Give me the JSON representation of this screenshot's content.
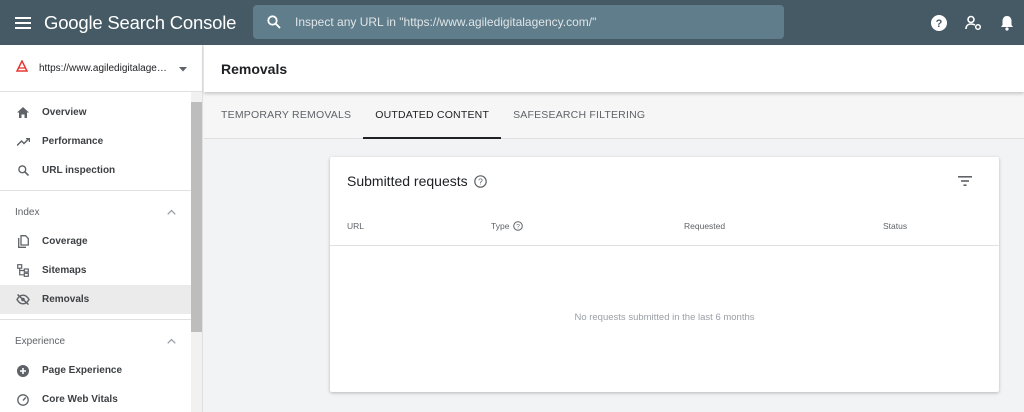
{
  "header": {
    "brand": "Google Search Console",
    "search_placeholder": "Inspect any URL in \"https://www.agiledigitalagency.com/\""
  },
  "sidebar": {
    "property_label": "https://www.agiledigitalagen...",
    "items_top": [
      {
        "label": "Overview",
        "icon": "home-icon"
      },
      {
        "label": "Performance",
        "icon": "trending-up-icon"
      },
      {
        "label": "URL inspection",
        "icon": "search-icon"
      }
    ],
    "index_section": {
      "title": "Index",
      "items": [
        {
          "label": "Coverage",
          "icon": "file-copy-icon"
        },
        {
          "label": "Sitemaps",
          "icon": "sitemap-icon"
        },
        {
          "label": "Removals",
          "icon": "visibility-off-icon",
          "active": true
        }
      ]
    },
    "experience_section": {
      "title": "Experience",
      "items": [
        {
          "label": "Page Experience",
          "icon": "add-circle-icon"
        },
        {
          "label": "Core Web Vitals",
          "icon": "speedometer-icon"
        }
      ]
    }
  },
  "main": {
    "page_title": "Removals",
    "tabs": [
      {
        "label": "TEMPORARY REMOVALS",
        "active": false
      },
      {
        "label": "OUTDATED CONTENT",
        "active": true
      },
      {
        "label": "SAFESEARCH FILTERING",
        "active": false
      }
    ],
    "card": {
      "title": "Submitted requests",
      "columns": [
        "URL",
        "Type",
        "Requested",
        "Status"
      ],
      "empty_message": "No requests submitted in the last 6 months"
    }
  },
  "colors": {
    "topbar": "#455a64",
    "search_bg": "#607d8b",
    "active_nav": "#ebebeb"
  }
}
